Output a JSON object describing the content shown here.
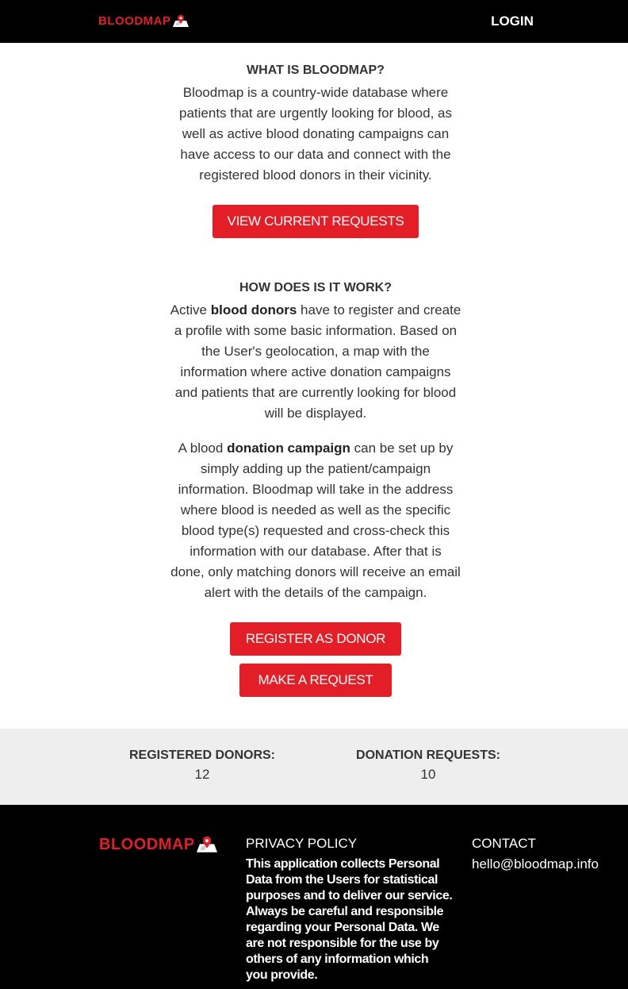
{
  "brand": {
    "logo_text": "BLOODMAP",
    "accent": "#e41e26"
  },
  "header": {
    "login_label": "LOGIN"
  },
  "about": {
    "title": "WHAT IS BLOODMAP?",
    "lines": [
      "Bloodmap is a country-wide database where",
      "patients that are urgently looking for blood, as",
      "well as active blood donating campaigns can",
      "have access to our data and connect with the",
      "registered blood donors in their vicinity."
    ],
    "button_label": "VIEW CURRENT REQUESTS"
  },
  "how": {
    "title": "HOW DOES IS IT WORK?",
    "para1": {
      "first_line_before": "Active ",
      "first_line_bold": "blood donors",
      "first_line_after": " have to register and create",
      "lines": [
        "a profile with some basic information. Based on",
        "the User's geolocation, a map with the",
        "information where active donation campaigns",
        "and patients that are currently looking for blood",
        "will be displayed."
      ]
    },
    "para2": {
      "first_line_before": "A blood ",
      "first_line_bold": "donation campaign",
      "first_line_after": " can be set up by",
      "lines": [
        "simply adding up the patient/campaign",
        "information. Bloodmap will take in the address",
        "where blood is needed as well as the specific",
        "blood type(s) requested and cross-check this",
        "information with our database. After that is",
        "done, only matching donors will receive an email",
        "alert with the details of the campaign."
      ]
    },
    "register_label": "REGISTER AS DONOR",
    "request_label": "MAKE A REQUEST"
  },
  "stats": {
    "donors_label": "REGISTERED DONORS:",
    "donors_value": "12",
    "requests_label": "DONATION REQUESTS:",
    "requests_value": "10"
  },
  "footer": {
    "privacy_title": "PRIVACY POLICY",
    "privacy_lines": [
      "This application collects Personal",
      "Data from the Users for statistical",
      "purposes and to deliver our service.",
      "Always be careful and responsible",
      "regarding your Personal Data. We",
      "are not responsible for the use by",
      "others of any information which",
      "you provide."
    ],
    "contact_title": "CONTACT",
    "contact_email": "hello@bloodmap.info"
  }
}
